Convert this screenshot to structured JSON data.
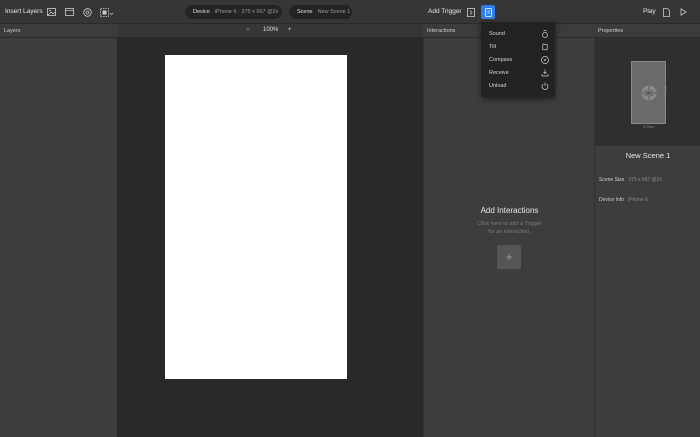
{
  "toolbar": {
    "insert_layers_label": "Insert Layers",
    "device_pill": {
      "label": "Device",
      "value": "iPhone 6 · 375 x 667 @2x"
    },
    "scene_pill": {
      "label": "Scene",
      "value": "New Scene 1"
    },
    "add_trigger_label": "Add Trigger",
    "play_label": "Play",
    "active_color": "#2f7ee8"
  },
  "panels": {
    "layers_header": "Layers",
    "interactions_header": "Interactions",
    "properties_header": "Properties"
  },
  "canvas": {
    "zoom_minus": "−",
    "zoom_level": "100%",
    "zoom_plus": "+"
  },
  "interactions": {
    "empty_title": "Add Interactions",
    "empty_line1": "Click here to add a Trigger",
    "empty_line2": "for an interaction.",
    "add_symbol": "+"
  },
  "properties": {
    "preview_width": "375px",
    "preview_height": "667px",
    "scene_name": "New Scene 1",
    "scene_size_label": "Scene Size",
    "scene_size_value": "375 x 667 @2x",
    "device_info_label": "Device Info",
    "device_info_value": "iPhone 6"
  },
  "trigger_menu": {
    "items": [
      {
        "label": "Sound",
        "icon": "sound-icon"
      },
      {
        "label": "Tilt",
        "icon": "tilt-icon"
      },
      {
        "label": "Compass",
        "icon": "compass-icon"
      },
      {
        "label": "Receive",
        "icon": "receive-icon"
      },
      {
        "label": "Unload",
        "icon": "power-icon"
      }
    ]
  }
}
